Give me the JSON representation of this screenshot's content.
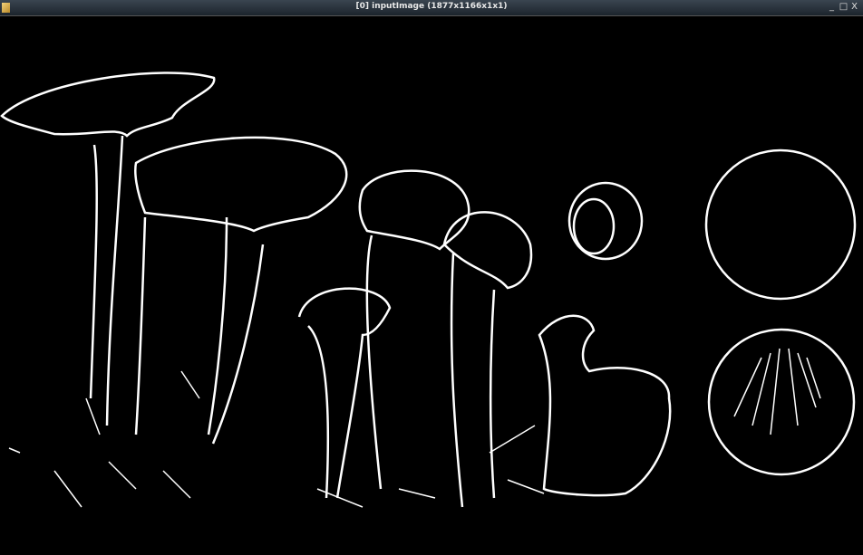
{
  "window": {
    "title": "[0] inputImage (1877x1166x1x1)",
    "controls": {
      "minimize": "_",
      "maximize": "□",
      "close": "X"
    }
  }
}
